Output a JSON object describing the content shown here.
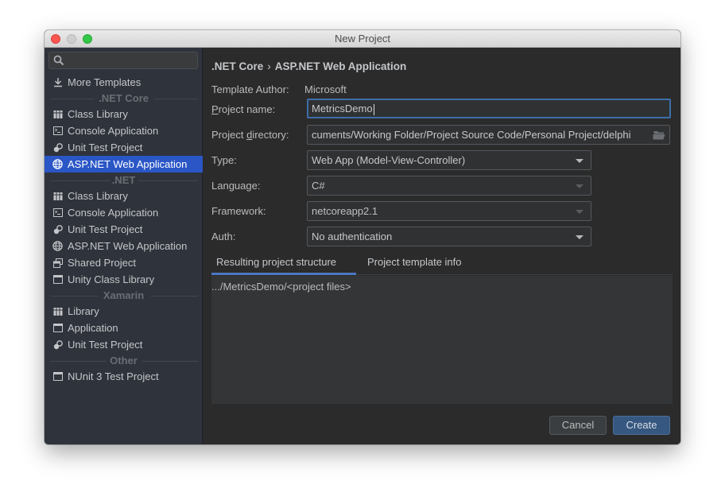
{
  "window": {
    "title": "New Project"
  },
  "sidebar": {
    "search": {
      "value": "",
      "placeholder": ""
    },
    "more_templates": "More Templates",
    "groups": [
      {
        "header": ".NET Core",
        "items": [
          {
            "label": "Class Library",
            "icon": "library-icon"
          },
          {
            "label": "Console Application",
            "icon": "console-icon"
          },
          {
            "label": "Unit Test Project",
            "icon": "unit-test-icon"
          },
          {
            "label": "ASP.NET Web Application",
            "icon": "globe-icon",
            "selected": true
          }
        ]
      },
      {
        "header": ".NET",
        "items": [
          {
            "label": "Class Library",
            "icon": "library-icon"
          },
          {
            "label": "Console Application",
            "icon": "console-icon"
          },
          {
            "label": "Unit Test Project",
            "icon": "unit-test-icon"
          },
          {
            "label": "ASP.NET Web Application",
            "icon": "globe-icon"
          },
          {
            "label": "Shared Project",
            "icon": "shared-project-icon"
          },
          {
            "label": "Unity Class Library",
            "icon": "window-icon"
          }
        ]
      },
      {
        "header": "Xamarin",
        "items": [
          {
            "label": "Library",
            "icon": "library-icon"
          },
          {
            "label": "Application",
            "icon": "window-icon"
          },
          {
            "label": "Unit Test Project",
            "icon": "unit-test-icon"
          }
        ]
      },
      {
        "header": "Other",
        "items": [
          {
            "label": "NUnit 3 Test Project",
            "icon": "window-icon"
          }
        ]
      }
    ]
  },
  "main": {
    "breadcrumb": {
      "parent": ".NET Core",
      "separator": "›",
      "current": "ASP.NET Web Application"
    },
    "template_author": {
      "label": "Template Author:",
      "value": "Microsoft"
    },
    "project_name": {
      "label_mnemonic": "P",
      "label_rest": "roject name:",
      "value": "MetricsDemo"
    },
    "project_directory": {
      "label_pre": "Project ",
      "label_mnemonic": "d",
      "label_rest": "irectory:",
      "value": "cuments/Working Folder/Project Source Code/Personal Project/delphi"
    },
    "type": {
      "label": "Type:",
      "value": "Web App (Model-View-Controller)"
    },
    "language": {
      "label": "Language:",
      "value": "C#",
      "disabled": true
    },
    "framework": {
      "label": "Framework:",
      "value": "netcoreapp2.1",
      "disabled": true
    },
    "auth": {
      "label": "Auth:",
      "value": "No authentication"
    },
    "tabs": [
      {
        "label": "Resulting project structure",
        "active": true
      },
      {
        "label": "Project template info",
        "active": false
      }
    ],
    "structure_path": ".../MetricsDemo/<project files>"
  },
  "buttons": {
    "cancel": "Cancel",
    "create": "Create"
  },
  "colors": {
    "selection": "#2a56c6",
    "primary_button": "#365880",
    "focus_border": "#3d6ea8",
    "tab_underline": "#4a78c2"
  }
}
